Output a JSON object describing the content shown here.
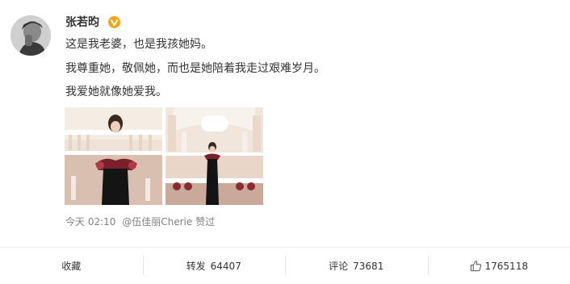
{
  "user": {
    "name": "张若昀",
    "badge_icon": "verified-v-icon"
  },
  "post": {
    "lines": [
      "这是我老婆，也是我孩她妈。",
      "我尊重她，敬佩她，而也是她陪着我走过艰难岁月。",
      "我爱她就像她爱我。"
    ],
    "images": [
      "photo-woman-black-dress",
      "photo-woman-black-dress-hall"
    ]
  },
  "meta": {
    "time": "今天 02:10",
    "liked_by": "@伍佳丽Cherie 赞过"
  },
  "actions": {
    "favorite_label": "收藏",
    "repost_label": "转发",
    "repost_count": "64407",
    "comment_label": "评论",
    "comment_count": "73681",
    "like_icon": "thumbs-up-icon",
    "like_count": "1765118"
  },
  "colors": {
    "badge": "#f7a31c",
    "meta_text": "#808080",
    "divider": "#eeeeee"
  }
}
